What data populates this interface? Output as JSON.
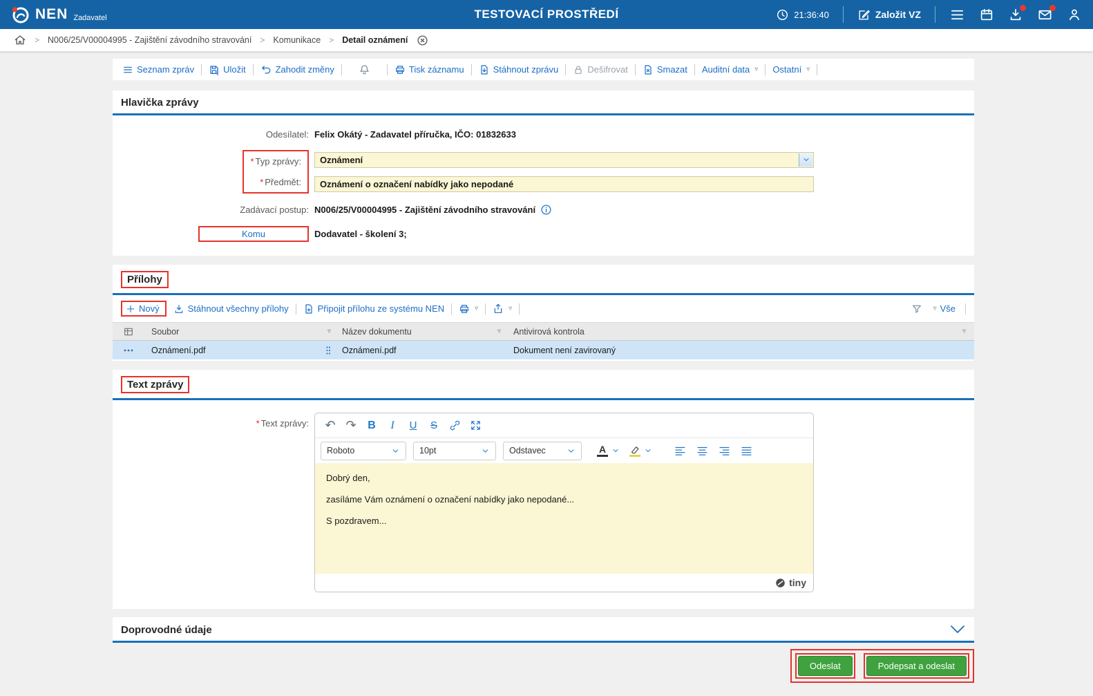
{
  "colors": {
    "header_blue": "#1563a5",
    "accent_blue": "#1a70b8",
    "link_blue": "#1b6ec8",
    "input_yellow": "#fbf6d3",
    "selected_row_blue": "#cfe4f7",
    "button_green": "#3fa23f",
    "annotation_red": "#e6332a"
  },
  "topbar": {
    "brand": "NEN",
    "brand_sub": "Zadavatel",
    "env_title": "TESTOVACÍ PROSTŘEDÍ",
    "time": "21:36:40",
    "create_vz_label": "Založit VZ"
  },
  "breadcrumb": {
    "items": [
      "N006/25/V00004995 - Zajištění závodního stravování",
      "Komunikace",
      "Detail oznámení"
    ]
  },
  "toolbar": {
    "seznam_zprav": "Seznam zpráv",
    "ulozit": "Uložit",
    "zahodit_zmeny": "Zahodit změny",
    "tisk_zaznamu": "Tisk záznamu",
    "stahnout_zpravu": "Stáhnout zprávu",
    "desifrovat": "Dešifrovat",
    "smazat": "Smazat",
    "auditni_data": "Auditní data",
    "ostatni": "Ostatní"
  },
  "required_marker": "*",
  "message_header": {
    "title": "Hlavička zprávy",
    "sender_label": "Odesílatel:",
    "sender_value": "Felix Okátý - Zadavatel příručka, IČO: 01832633",
    "type_label": "Typ zprávy:",
    "type_value": "Oznámení",
    "subject_label": "Předmět:",
    "subject_value": "Oznámení o označení nabídky jako nepodané",
    "procedure_label": "Zadávací postup:",
    "procedure_value": "N006/25/V00004995 - Zajištění závodního stravování",
    "to_label": "Komu",
    "to_value": "Dodavatel - školení 3;"
  },
  "attachments": {
    "title": "Přílohy",
    "novy_label": "Nový",
    "download_all_label": "Stáhnout všechny přílohy",
    "attach_nen_label": "Připojit přílohu ze systému NEN",
    "vse_label": "Vše",
    "columns": [
      "Soubor",
      "Název dokumentu",
      "Antivirová kontrola"
    ],
    "rows": [
      {
        "soubor": "Oznámení.pdf",
        "nazev_dokumentu": "Oznámení.pdf",
        "antivirova_kontrola": "Dokument není zavirovaný"
      }
    ]
  },
  "message_text": {
    "title": "Text zprávy",
    "label": "Text zprávy:",
    "editor": {
      "font_name": "Roboto",
      "font_size": "10pt",
      "block_format": "Odstavec",
      "paragraphs": [
        "Dobrý den,",
        "zasíláme Vám oznámení o označení nabídky jako nepodané...",
        "S pozdravem..."
      ],
      "brand": "tiny"
    }
  },
  "additional_section": {
    "title": "Doprovodné údaje"
  },
  "footer": {
    "odeslat_label": "Odeslat",
    "podepsat_label": "Podepsat a odeslat"
  }
}
